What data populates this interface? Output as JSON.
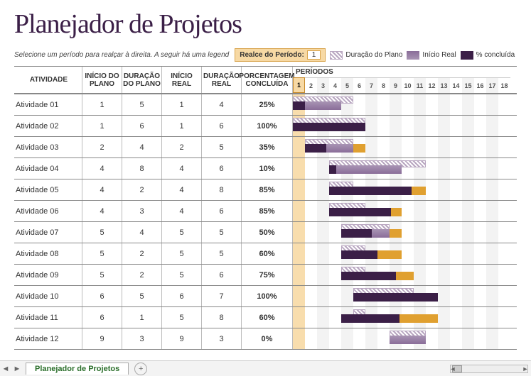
{
  "title": "Planejador de Projetos",
  "instruction": "Selecione um período para realçar à direita.  A seguir há uma legend",
  "highlight_label": "Realce do Período:",
  "highlight_value": "1",
  "legend": {
    "plan": "Duração do Plano",
    "real": "Início Real",
    "pct": "% concluída"
  },
  "columns": {
    "activity": "ATIVIDADE",
    "plan_start": "INÍCIO DO PLANO",
    "plan_dur": "DURAÇÃO DO PLANO",
    "real_start": "INÍCIO REAL",
    "real_dur": "DURAÇÃO REAL",
    "pct": "PORCENTAGEM CONCLUÍDA",
    "periods": "PERÍODOS"
  },
  "period_count": 18,
  "highlight_period": 1,
  "rows": [
    {
      "name": "Atividade 01",
      "ps": 1,
      "pd": 5,
      "rs": 1,
      "rd": 4,
      "pct": 25
    },
    {
      "name": "Atividade 02",
      "ps": 1,
      "pd": 6,
      "rs": 1,
      "rd": 6,
      "pct": 100
    },
    {
      "name": "Atividade 03",
      "ps": 2,
      "pd": 4,
      "rs": 2,
      "rd": 5,
      "pct": 35
    },
    {
      "name": "Atividade 04",
      "ps": 4,
      "pd": 8,
      "rs": 4,
      "rd": 6,
      "pct": 10
    },
    {
      "name": "Atividade 05",
      "ps": 4,
      "pd": 2,
      "rs": 4,
      "rd": 8,
      "pct": 85
    },
    {
      "name": "Atividade 06",
      "ps": 4,
      "pd": 3,
      "rs": 4,
      "rd": 6,
      "pct": 85
    },
    {
      "name": "Atividade 07",
      "ps": 5,
      "pd": 4,
      "rs": 5,
      "rd": 5,
      "pct": 50
    },
    {
      "name": "Atividade 08",
      "ps": 5,
      "pd": 2,
      "rs": 5,
      "rd": 5,
      "pct": 60
    },
    {
      "name": "Atividade 09",
      "ps": 5,
      "pd": 2,
      "rs": 5,
      "rd": 6,
      "pct": 75
    },
    {
      "name": "Atividade 10",
      "ps": 6,
      "pd": 5,
      "rs": 6,
      "rd": 7,
      "pct": 100
    },
    {
      "name": "Atividade 11",
      "ps": 6,
      "pd": 1,
      "rs": 5,
      "rd": 8,
      "pct": 60
    },
    {
      "name": "Atividade 12",
      "ps": 9,
      "pd": 3,
      "rs": 9,
      "rd": 3,
      "pct": 0
    }
  ],
  "sheet_tab": "Planejador de Projetos",
  "chart_data": {
    "type": "table",
    "title": "Planejador de Projetos — Gantt",
    "columns": [
      "Atividade",
      "Início do Plano",
      "Duração do Plano",
      "Início Real",
      "Duração Real",
      "% Concluída"
    ],
    "rows": [
      [
        "Atividade 01",
        1,
        5,
        1,
        4,
        25
      ],
      [
        "Atividade 02",
        1,
        6,
        1,
        6,
        100
      ],
      [
        "Atividade 03",
        2,
        4,
        2,
        5,
        35
      ],
      [
        "Atividade 04",
        4,
        8,
        4,
        6,
        10
      ],
      [
        "Atividade 05",
        4,
        2,
        4,
        8,
        85
      ],
      [
        "Atividade 06",
        4,
        3,
        4,
        6,
        85
      ],
      [
        "Atividade 07",
        5,
        4,
        5,
        5,
        50
      ],
      [
        "Atividade 08",
        5,
        2,
        5,
        5,
        60
      ],
      [
        "Atividade 09",
        5,
        2,
        5,
        6,
        75
      ],
      [
        "Atividade 10",
        6,
        5,
        6,
        7,
        100
      ],
      [
        "Atividade 11",
        6,
        1,
        5,
        8,
        60
      ],
      [
        "Atividade 12",
        9,
        3,
        9,
        3,
        0
      ]
    ],
    "period_range": [
      1,
      18
    ],
    "highlight_period": 1
  }
}
